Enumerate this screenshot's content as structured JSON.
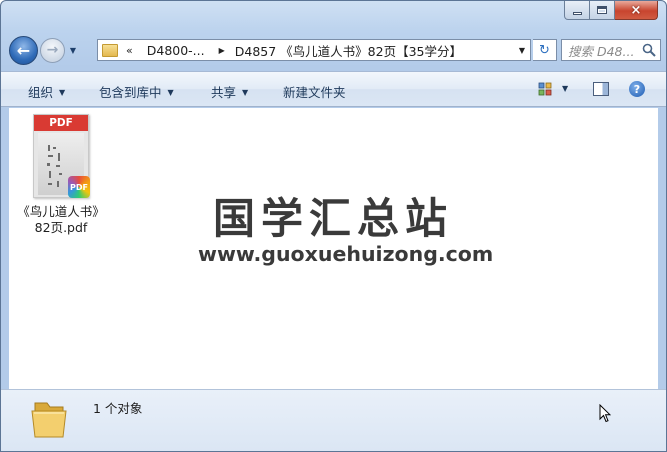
{
  "window": {
    "caption": {
      "minimize": "minimize",
      "maximize": "maximize",
      "close": "×"
    }
  },
  "nav": {
    "back_glyph": "←",
    "forward_glyph": "→",
    "address": {
      "chevron": "«",
      "crumb1": "D4800-...",
      "crumb2": "D4857 《鸟儿道人书》82页【35学分】"
    },
    "refresh_glyph": "↻",
    "search_placeholder": "搜索 D48..."
  },
  "toolbar": {
    "organize": "组织",
    "include_library": "包含到库中",
    "share": "共享",
    "new_folder": "新建文件夹",
    "help_glyph": "?"
  },
  "files": [
    {
      "name_line1": "《鸟儿道人书》",
      "name_line2": "82页.pdf",
      "thumb_label": "PDF",
      "badge_label": "PDF"
    }
  ],
  "watermark": {
    "title": "国学汇总站",
    "url": "www.guoxuehuizong.com"
  },
  "details": {
    "status": "1 个对象"
  },
  "colors": {
    "pdf_red": "#d93a33",
    "toolbar_text": "#1e395b",
    "close_red": "#c8452f"
  }
}
